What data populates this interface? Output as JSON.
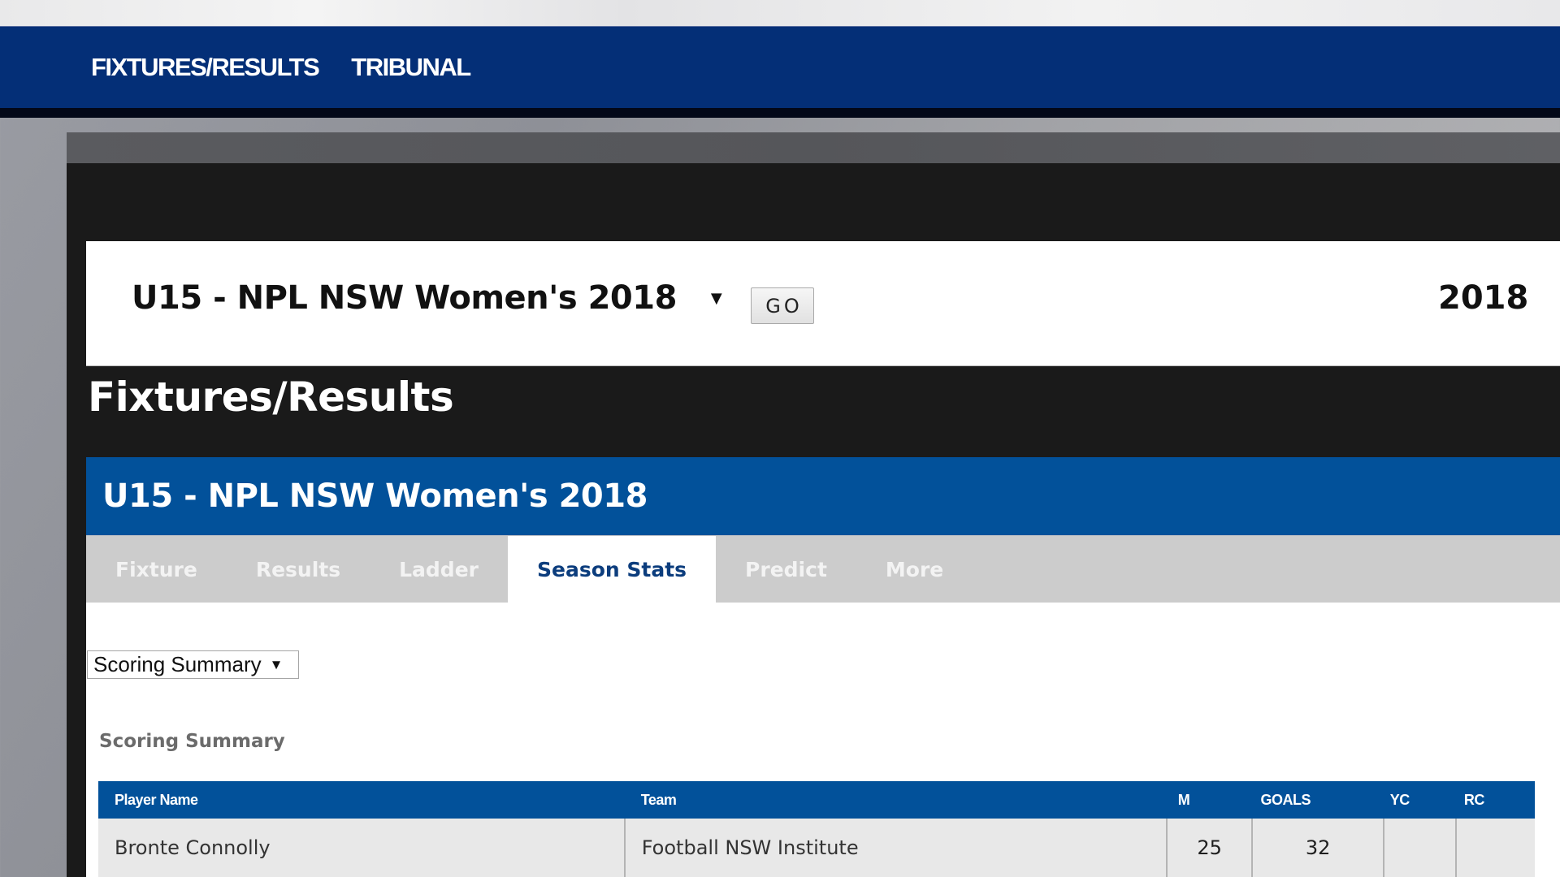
{
  "nav": {
    "links": [
      {
        "label": "FIXTURES/RESULTS"
      },
      {
        "label": "TRIBUNAL"
      }
    ]
  },
  "selector": {
    "competition": "U15 - NPL NSW Women's 2018",
    "go_label": "GO",
    "year": "2018",
    "caret": "▼"
  },
  "page": {
    "title": "Fixtures/Results"
  },
  "competition_header": {
    "title": "U15 - NPL NSW Women's 2018"
  },
  "tabs": [
    {
      "label": "Fixture",
      "active": false
    },
    {
      "label": "Results",
      "active": false
    },
    {
      "label": "Ladder",
      "active": false
    },
    {
      "label": "Season Stats",
      "active": true
    },
    {
      "label": "Predict",
      "active": false
    },
    {
      "label": "More",
      "active": false
    }
  ],
  "stats": {
    "select_value": "Scoring Summary",
    "section_label": "Scoring Summary",
    "columns": [
      "Player Name",
      "Team",
      "M",
      "GOALS",
      "YC",
      "RC"
    ],
    "rows": [
      {
        "player": "Bronte Connolly",
        "team": "Football NSW Institute",
        "m": "25",
        "goals": "32",
        "yc": "",
        "rc": ""
      }
    ]
  },
  "colors": {
    "nav_blue": "#042f77",
    "header_blue": "#02519a",
    "active_tab_text": "#0c3d7d",
    "tab_bg": "#cccccc",
    "panel_dark": "#1a1a1a"
  }
}
